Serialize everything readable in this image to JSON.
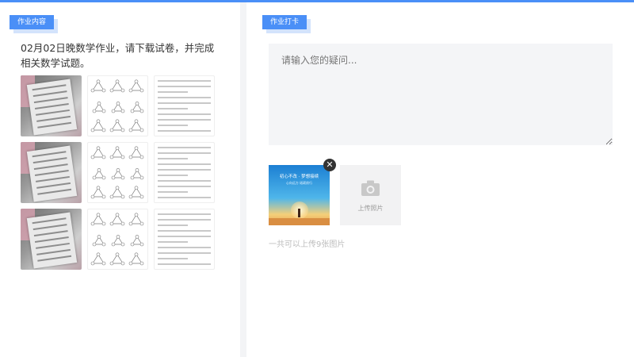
{
  "left_panel": {
    "tag": "作业内容",
    "description": "02月02日晚数学作业，请下载试卷，并完成相关数学试题。",
    "attachments": [
      {
        "kind": "photo",
        "icon": "worksheet-photo"
      },
      {
        "kind": "diagram",
        "icon": "triangle-diagram"
      },
      {
        "kind": "text",
        "icon": "text-sheet"
      },
      {
        "kind": "photo",
        "icon": "worksheet-photo"
      },
      {
        "kind": "diagram",
        "icon": "triangle-diagram"
      },
      {
        "kind": "text",
        "icon": "text-sheet"
      },
      {
        "kind": "photo",
        "icon": "worksheet-photo"
      },
      {
        "kind": "diagram",
        "icon": "triangle-diagram"
      },
      {
        "kind": "text",
        "icon": "text-sheet"
      }
    ]
  },
  "right_panel": {
    "tag": "作业打卡",
    "question_input": {
      "placeholder": "请输入您的疑问...",
      "value": ""
    },
    "uploaded_image": {
      "title": "初心不改 · 梦想接续",
      "subtitle": "心向远方 砥砺前行"
    },
    "upload_button": {
      "label": "上传照片"
    },
    "hint": "一共可以上传9张图片"
  },
  "colors": {
    "accent": "#4a8ff7",
    "tag_shadow": "#d3e3fc",
    "background": "#f3f4f6"
  }
}
